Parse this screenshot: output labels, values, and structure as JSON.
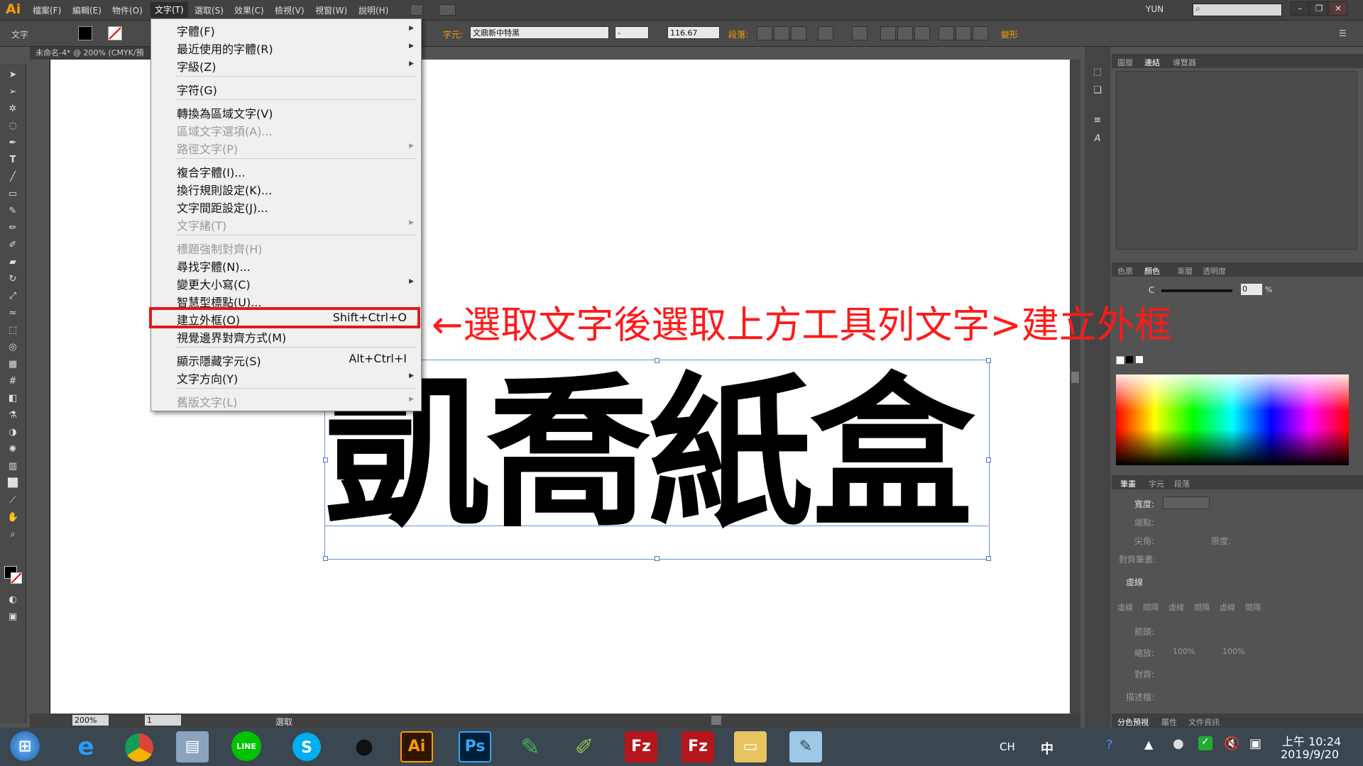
{
  "app": {
    "logo": "Ai"
  },
  "menubar": {
    "items": [
      "檔案(F)",
      "編輯(E)",
      "物件(O)",
      "文字(T)",
      "選取(S)",
      "效果(C)",
      "檢視(V)",
      "視窗(W)",
      "說明(H)"
    ],
    "user": "YUN"
  },
  "controlbar": {
    "tool_label": "文字",
    "char_label": "字元:",
    "font_name": "文鼎新中特黑",
    "font_style": "-",
    "font_size": "116.67",
    "para_label": "段落:",
    "transform_label": "變形"
  },
  "document": {
    "tab_title": "未命名-4* @ 200% (CMYK/預"
  },
  "type_menu": {
    "items": [
      {
        "label": "字體(F)",
        "arrow": true,
        "disabled": false
      },
      {
        "label": "最近使用的字體(R)",
        "arrow": true,
        "disabled": false
      },
      {
        "label": "字級(Z)",
        "arrow": true,
        "disabled": false
      },
      {
        "label": "字符(G)",
        "disabled": false
      },
      {
        "label": "轉換為區域文字(V)",
        "disabled": false
      },
      {
        "label": "區域文字選項(A)...",
        "disabled": true
      },
      {
        "label": "路徑文字(P)",
        "arrow": true,
        "disabled": true
      },
      {
        "label": "複合字體(I)...",
        "disabled": false
      },
      {
        "label": "換行規則設定(K)...",
        "disabled": false
      },
      {
        "label": "文字間距設定(J)...",
        "disabled": false
      },
      {
        "label": "文字緒(T)",
        "arrow": true,
        "disabled": true
      },
      {
        "label": "標題強制對齊(H)",
        "disabled": true
      },
      {
        "label": "尋找字體(N)...",
        "disabled": false
      },
      {
        "label": "變更大小寫(C)",
        "arrow": true,
        "disabled": false
      },
      {
        "label": "智慧型標點(U)...",
        "disabled": false
      },
      {
        "label": "建立外框(O)",
        "shortcut": "Shift+Ctrl+O",
        "disabled": false
      },
      {
        "label": "視覺邊界對齊方式(M)",
        "disabled": false
      },
      {
        "label": "顯示隱藏字元(S)",
        "shortcut": "Alt+Ctrl+I",
        "disabled": false
      },
      {
        "label": "文字方向(Y)",
        "arrow": true,
        "disabled": false
      },
      {
        "label": "舊版文字(L)",
        "arrow": true,
        "disabled": true
      }
    ]
  },
  "annotation": "←選取文字後選取上方工具列文字>建立外框",
  "canvas": {
    "text": "凱喬紙盒"
  },
  "statusbar": {
    "zoom": "200%",
    "page": "1",
    "mode": "選取"
  },
  "right_panel": {
    "top_tabs": [
      "圖層",
      "連結",
      "導覽器"
    ],
    "color_tabs": [
      "色票",
      "顏色",
      "漸層",
      "透明度"
    ],
    "color_c_label": "C",
    "color_c_value": "0",
    "percent": "%",
    "stroke_tabs": [
      "筆畫",
      "字元",
      "段落"
    ],
    "stroke_width_label": "寬度:",
    "cap_label": "端點:",
    "corner_label": "尖角:",
    "limit_label": "限度:",
    "align_label": "對齊筆畫:",
    "dash_label": "虛線",
    "dash_cells": [
      "虛線",
      "間隔",
      "虛線",
      "間隔",
      "虛線",
      "間隔"
    ],
    "arrow_label": "箭頭:",
    "scale_label": "縮放:",
    "scale_values": [
      "100%",
      "100%"
    ],
    "align2_label": "對齊:",
    "profile_label": "描述檔:",
    "bottom_tabs": [
      "分色預視",
      "屬性",
      "文件資訊"
    ]
  },
  "taskbar": {
    "lang": "CH",
    "ime": "中",
    "time": "上午 10:24",
    "date": "2019/9/20",
    "apps": [
      "windows-start",
      "internet-explorer",
      "chrome",
      "explorer-window",
      "line",
      "skype",
      "qq",
      "illustrator",
      "photoshop",
      "coreldraw",
      "corel-app",
      "filezilla-blue",
      "filezilla-red",
      "folder",
      "notes"
    ]
  },
  "colors": {
    "accent": "#ff9a00",
    "highlight_red": "#e5161c",
    "selection_blue": "#4a73c8"
  }
}
